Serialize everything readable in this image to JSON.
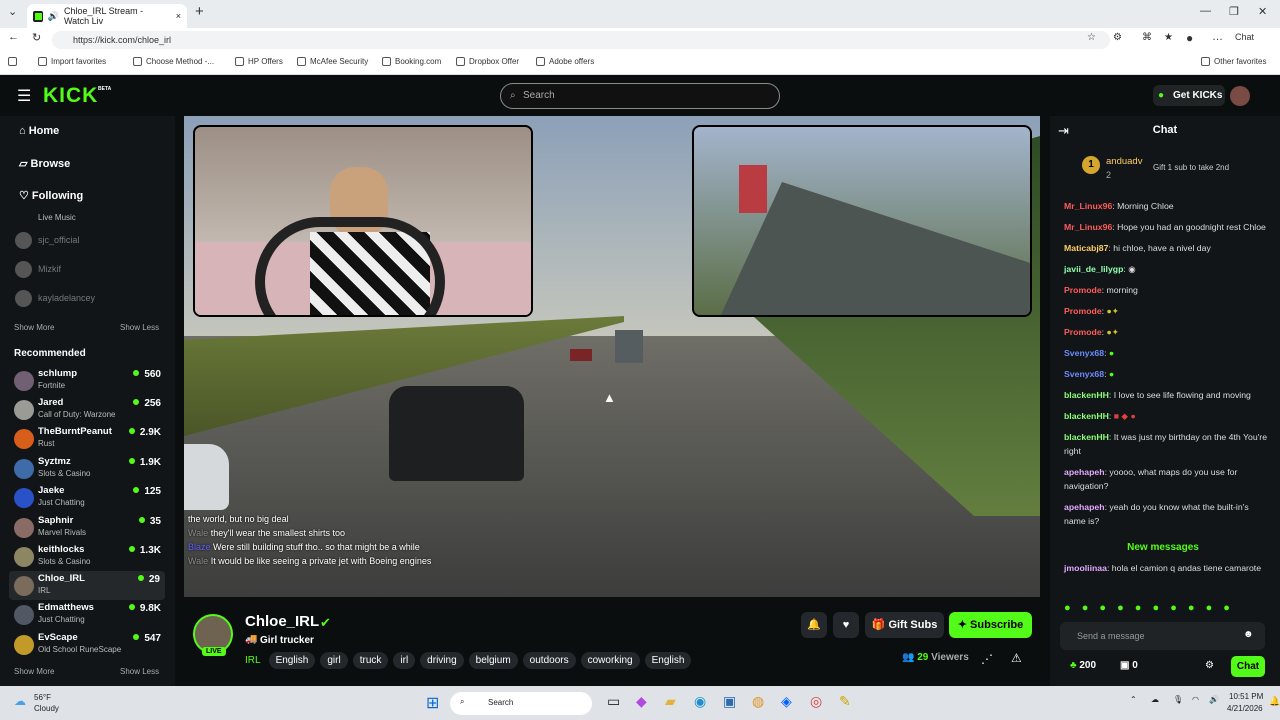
{
  "browser": {
    "tab_title": "Chloe_IRL Stream - Watch Liv",
    "url": "https://kick.com/chloe_irl",
    "chat_label": "Chat",
    "bookmarks": [
      "Import favorites",
      "Choose Method -...",
      "HP Offers",
      "McAfee Security",
      "Booking.com",
      "Dropbox Offer",
      "Adobe offers"
    ],
    "other_favorites": "Other favorites"
  },
  "kick": {
    "logo": "KICK",
    "beta": "BETA",
    "search_placeholder": "Search",
    "get_kicks": "Get KICKs"
  },
  "sidebar": {
    "nav": [
      "Home",
      "Browse",
      "Following"
    ],
    "following": [
      {
        "name": "Live Music"
      },
      {
        "name": "sjc_official"
      },
      {
        "name": "Mizkif"
      },
      {
        "name": "kayladelancey"
      }
    ],
    "show_more": "Show More",
    "show_less": "Show Less",
    "recommended_title": "Recommended",
    "recommended": [
      {
        "name": "schlump",
        "game": "Fortnite",
        "viewers": "560"
      },
      {
        "name": "Jared",
        "game": "Call of Duty: Warzone",
        "viewers": "256"
      },
      {
        "name": "TheBurntPeanut",
        "game": "Rust",
        "viewers": "2.9K"
      },
      {
        "name": "Syztmz",
        "game": "Slots & Casino",
        "viewers": "1.9K"
      },
      {
        "name": "Jaeke",
        "game": "Just Chatting",
        "viewers": "125"
      },
      {
        "name": "Saphnir",
        "game": "Marvel Rivals",
        "viewers": "35"
      },
      {
        "name": "keithlocks",
        "game": "Slots & Casino",
        "viewers": "1.3K"
      },
      {
        "name": "Chloe_IRL",
        "game": "IRL",
        "viewers": "29"
      },
      {
        "name": "Edmatthews",
        "game": "Just Chatting",
        "viewers": "9.8K"
      },
      {
        "name": "EvScape",
        "game": "Old School RuneScape",
        "viewers": "547"
      }
    ]
  },
  "overlay_chat": [
    {
      "user": "",
      "text": "the world, but no big deal"
    },
    {
      "user": "Wale",
      "text": "they'll wear the smallest shirts too"
    },
    {
      "user": "Blaze",
      "text": "Were still building stuff tho.. so that might be a while"
    },
    {
      "user": "Wale",
      "text": "It would be like seeing a private jet with Boeing engines"
    }
  ],
  "stream": {
    "channel": "Chloe_IRL",
    "category": "Girl trucker",
    "live": "LIVE",
    "irl": "IRL",
    "tags": [
      "English",
      "girl",
      "truck",
      "irl",
      "driving",
      "belgium",
      "outdoors",
      "coworking",
      "English"
    ],
    "gift_subs": "Gift Subs",
    "subscribe": "Subscribe",
    "viewers": "29",
    "viewers_label": "Viewers"
  },
  "chat": {
    "title": "Chat",
    "pinned_user": "anduadv",
    "pinned_count": "2",
    "gift_text": "Gift 1 sub to take 2nd",
    "messages": [
      {
        "user": "Mr_Linux96",
        "text": "Morning Chloe",
        "color": "#ff5b5b"
      },
      {
        "user": "Mr_Linux96",
        "text": "Hope you had an goodnight rest Chloe",
        "color": "#ff5b5b"
      },
      {
        "user": "Maticabj87",
        "text": "hi chloe, have a nivel day",
        "color": "#ffcc66"
      },
      {
        "user": "javii_de_lilygp",
        "text": "",
        "color": "#93ffb1"
      },
      {
        "user": "Promode",
        "text": "morning",
        "color": "#ff5b5b"
      },
      {
        "user": "Promode",
        "text": "",
        "color": "#ff5b5b"
      },
      {
        "user": "Promode",
        "text": "",
        "color": "#ff5b5b"
      },
      {
        "user": "Svenyx68",
        "text": "",
        "color": "#6d8cff"
      },
      {
        "user": "Svenyx68",
        "text": "",
        "color": "#6d8cff"
      },
      {
        "user": "blackenHH",
        "text": "I love to see life flowing and moving",
        "color": "#8cff77"
      },
      {
        "user": "blackenHH",
        "text": "",
        "color": "#8cff77"
      },
      {
        "user": "blackenHH",
        "text": "It was just my birthday on the 4th You're right",
        "color": "#8cff77"
      },
      {
        "user": "apehapeh",
        "text": "yoooo, what maps do you use for navigation?",
        "color": "#e3a9ff"
      },
      {
        "user": "apehapeh",
        "text": "yeah do you know what the built-in's name is?",
        "color": "#e3a9ff"
      }
    ],
    "new_messages": "New messages",
    "latest": {
      "user": "jmooliinaa",
      "text": "hola el camion q andas tiene camarote",
      "color": "#e3a9ff"
    },
    "placeholder": "Send a message",
    "points": "200",
    "items": "0",
    "chat_button": "Chat"
  },
  "taskbar": {
    "temp": "56°F",
    "weather": "Cloudy",
    "search": "Search",
    "time": "10:51 PM",
    "date": "4/21/2026"
  }
}
